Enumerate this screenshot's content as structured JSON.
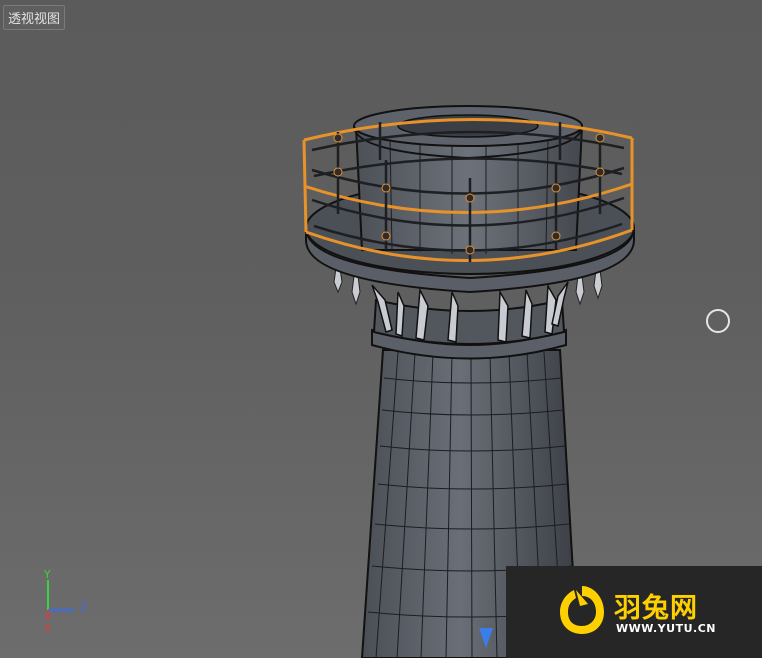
{
  "viewport": {
    "label": "透视视图",
    "background_color": "#5f5f5f",
    "selection_color": "#e8922a"
  },
  "axis_gizmo": {
    "y_label": "Y",
    "z_label": "Z",
    "x_label": "X",
    "y_color": "#3bd33b",
    "z_color": "#3a6cf0",
    "x_color": "#e03a3a"
  },
  "watermark": {
    "title": "羽兔网",
    "url": "WWW.YUTU.CN",
    "accent_color": "#ffd000"
  },
  "icons": {
    "navigation": "nav-circle-icon",
    "axis": "axis-gizmo-icon",
    "marker": "triangle-down-icon",
    "logo": "rabbit-logo-icon"
  }
}
